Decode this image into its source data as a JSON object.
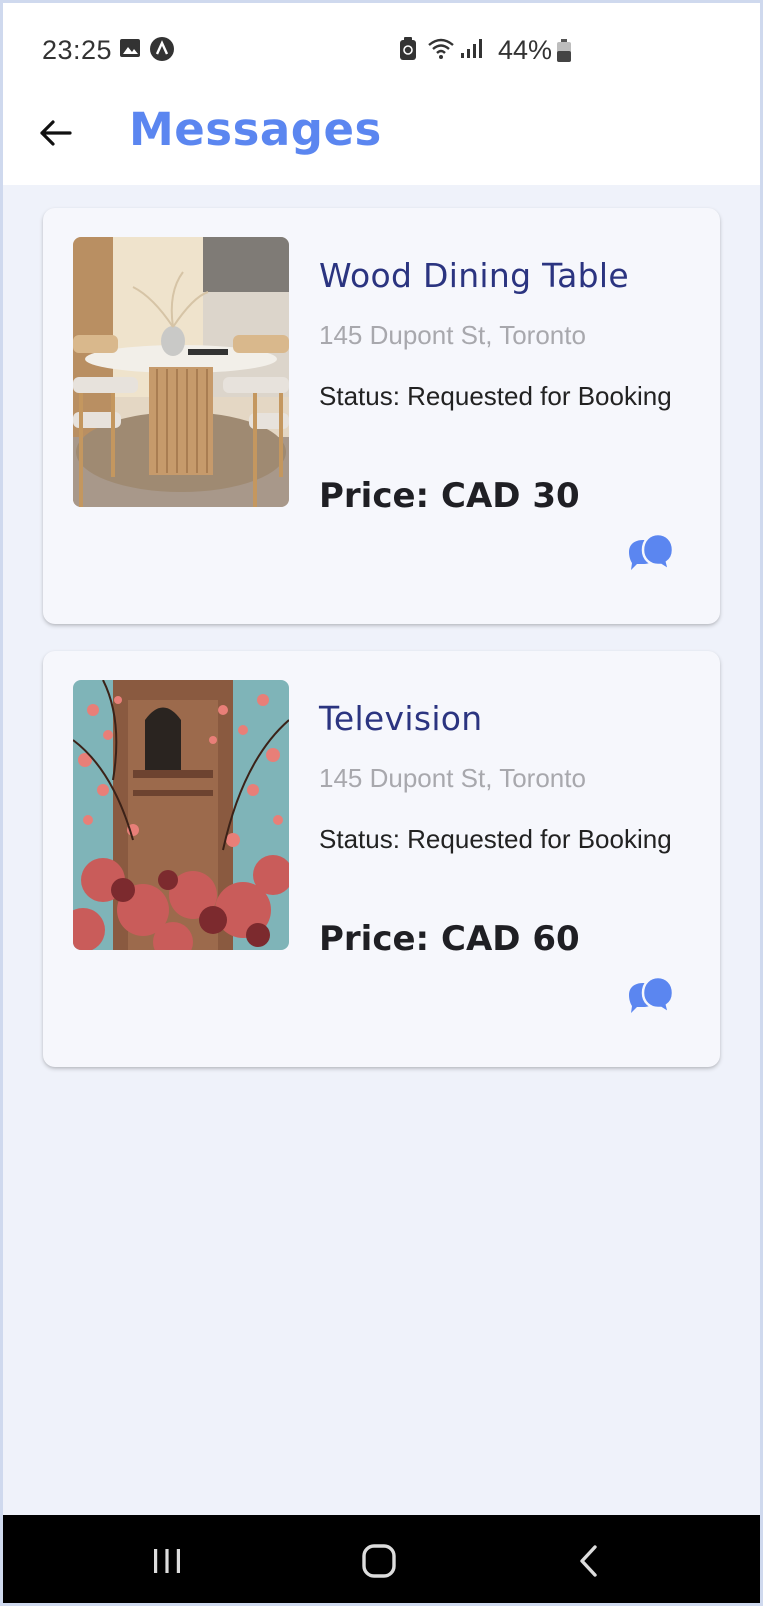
{
  "status_bar": {
    "time": "23:25",
    "battery_text": "44%",
    "left_icons": [
      "image-icon",
      "app-notification-icon"
    ],
    "right_icons": [
      "device-icon",
      "wifi-icon",
      "signal-icon",
      "battery-icon"
    ]
  },
  "header": {
    "title": "Messages",
    "back_icon": "arrow-left-icon",
    "title_color": "#5b86f0"
  },
  "listings": [
    {
      "title": "Wood Dining Table",
      "address": "145 Dupont St, Toronto",
      "status": "Status: Requested for Booking",
      "price": "Price: CAD 30",
      "image": "dining-table-photo",
      "action_icon": "chat-bubbles-icon"
    },
    {
      "title": "Television",
      "address": "145 Dupont St, Toronto",
      "status": "Status: Requested for Booking",
      "price": "Price: CAD 60",
      "image": "blossom-tower-photo",
      "action_icon": "chat-bubbles-icon"
    }
  ],
  "nav_bar": {
    "buttons": [
      "recents-icon",
      "home-icon",
      "back-icon"
    ]
  },
  "colors": {
    "accent": "#5b86f0",
    "title_text": "#2b3480",
    "card_bg": "#f6f7fc",
    "page_bg": "#eff2fa"
  }
}
